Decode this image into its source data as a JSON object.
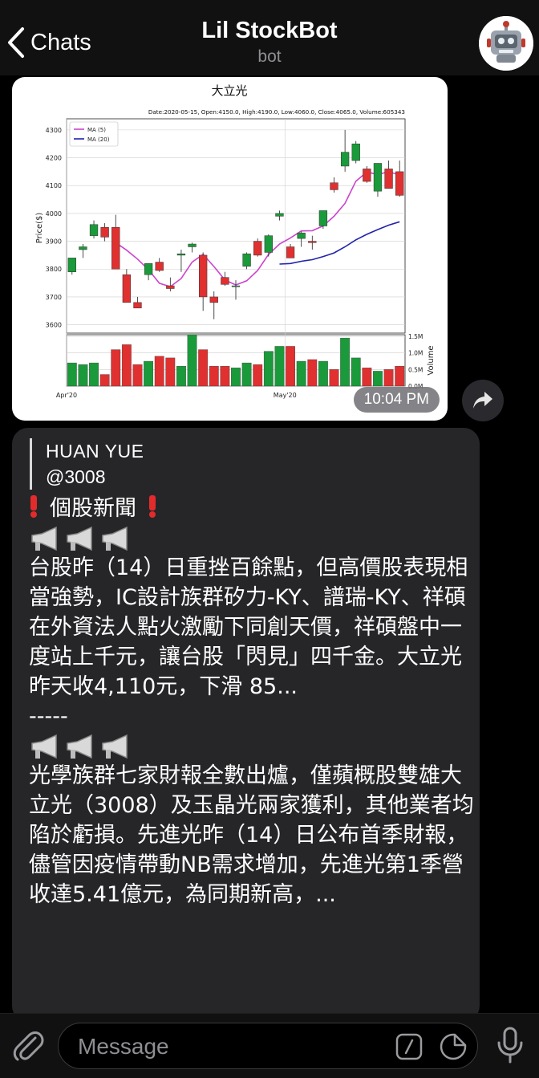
{
  "header": {
    "back_label": "Chats",
    "title": "Lil StockBot",
    "subtitle": "bot"
  },
  "image_message": {
    "time": "10:04 PM"
  },
  "chart_data": {
    "type": "candlestick",
    "title": "大立光",
    "subtitle": "Date:2020-05-15, Open:4150.0, High:4190.0, Low:4060.0, Close:4065.0, Volume:605343",
    "ylabel": "Price($)",
    "ylim": [
      3570,
      4340
    ],
    "yticks": [
      "3600",
      "3700",
      "3800",
      "3900",
      "4000",
      "4100",
      "4200",
      "4300"
    ],
    "x_ticks": [
      "Apr'20",
      "May'20"
    ],
    "volume_label": "Volume",
    "volume_ticks": [
      "0.0M",
      "0.5M",
      "1.0M",
      "1.5M"
    ],
    "volume_max": 1.55,
    "legend": [
      "MA (5)",
      "MA (20)"
    ],
    "colors": {
      "up": "#1a9a3a",
      "down": "#e03030",
      "ma5": "#cc44cc",
      "ma20": "#2222aa"
    },
    "candles": [
      {
        "o": 3790,
        "h": 3840,
        "l": 3780,
        "c": 3840,
        "v": 0.7
      },
      {
        "o": 3870,
        "h": 3890,
        "l": 3840,
        "c": 3880,
        "v": 0.65
      },
      {
        "o": 3920,
        "h": 3975,
        "l": 3910,
        "c": 3960,
        "v": 0.7
      },
      {
        "o": 3950,
        "h": 3965,
        "l": 3900,
        "c": 3915,
        "v": 0.35
      },
      {
        "o": 3950,
        "h": 3995,
        "l": 3800,
        "c": 3800,
        "v": 1.1
      },
      {
        "o": 3780,
        "h": 3800,
        "l": 3680,
        "c": 3680,
        "v": 1.25
      },
      {
        "o": 3680,
        "h": 3700,
        "l": 3660,
        "c": 3660,
        "v": 0.65
      },
      {
        "o": 3780,
        "h": 3820,
        "l": 3760,
        "c": 3820,
        "v": 0.75
      },
      {
        "o": 3825,
        "h": 3840,
        "l": 3790,
        "c": 3795,
        "v": 0.9
      },
      {
        "o": 3740,
        "h": 3770,
        "l": 3720,
        "c": 3730,
        "v": 0.85
      },
      {
        "o": 3850,
        "h": 3870,
        "l": 3790,
        "c": 3855,
        "v": 0.6
      },
      {
        "o": 3880,
        "h": 3895,
        "l": 3860,
        "c": 3890,
        "v": 1.7
      },
      {
        "o": 3850,
        "h": 3860,
        "l": 3650,
        "c": 3700,
        "v": 1.1
      },
      {
        "o": 3700,
        "h": 3720,
        "l": 3620,
        "c": 3680,
        "v": 0.6
      },
      {
        "o": 3770,
        "h": 3790,
        "l": 3740,
        "c": 3745,
        "v": 0.6
      },
      {
        "o": 3740,
        "h": 3760,
        "l": 3690,
        "c": 3740,
        "v": 0.55
      },
      {
        "o": 3810,
        "h": 3860,
        "l": 3800,
        "c": 3855,
        "v": 0.7
      },
      {
        "o": 3900,
        "h": 3910,
        "l": 3845,
        "c": 3850,
        "v": 0.65
      },
      {
        "o": 3860,
        "h": 3925,
        "l": 3845,
        "c": 3920,
        "v": 1.05
      },
      {
        "o": 3990,
        "h": 4010,
        "l": 3975,
        "c": 4000,
        "v": 1.2
      },
      {
        "o": 3880,
        "h": 3890,
        "l": 3840,
        "c": 3840,
        "v": 1.2
      },
      {
        "o": 3910,
        "h": 3935,
        "l": 3880,
        "c": 3930,
        "v": 0.75
      },
      {
        "o": 3900,
        "h": 3920,
        "l": 3870,
        "c": 3895,
        "v": 0.8
      },
      {
        "o": 3955,
        "h": 4010,
        "l": 3945,
        "c": 4010,
        "v": 0.75
      },
      {
        "o": 4110,
        "h": 4130,
        "l": 4075,
        "c": 4085,
        "v": 0.5
      },
      {
        "o": 4170,
        "h": 4300,
        "l": 4150,
        "c": 4220,
        "v": 1.45
      },
      {
        "o": 4190,
        "h": 4260,
        "l": 4180,
        "c": 4250,
        "v": 0.85
      },
      {
        "o": 4160,
        "h": 4170,
        "l": 4110,
        "c": 4115,
        "v": 0.55
      },
      {
        "o": 4080,
        "h": 4180,
        "l": 4060,
        "c": 4180,
        "v": 0.45
      },
      {
        "o": 4160,
        "h": 4190,
        "l": 4090,
        "c": 4090,
        "v": 0.5
      },
      {
        "o": 4150,
        "h": 4190,
        "l": 4060,
        "c": 4065,
        "v": 0.6
      }
    ],
    "ma5": [
      null,
      null,
      null,
      null,
      3895,
      3868,
      3836,
      3798,
      3749,
      3737,
      3766,
      3825,
      3853,
      3809,
      3761,
      3743,
      3758,
      3795,
      3853,
      3890,
      3912,
      3937,
      3938,
      3955,
      3990,
      4036,
      4116,
      4149,
      4140,
      4150,
      4138
    ],
    "ma20": [
      null,
      null,
      null,
      null,
      null,
      null,
      null,
      null,
      null,
      null,
      null,
      null,
      null,
      null,
      null,
      null,
      null,
      null,
      null,
      3818,
      3820,
      3828,
      3834,
      3845,
      3858,
      3880,
      3905,
      3925,
      3942,
      3958,
      3970
    ]
  },
  "forwarded_message": {
    "author": "HUAN YUE",
    "handle": "@3008",
    "header_line": "個股新聞",
    "paragraph1": "台股昨（14）日重挫百餘點，但高價股表現相當強勢，IC設計族群矽力-KY、譜瑞-KY、祥碩在外資法人點火激勵下同創天價，祥碩盤中一度站上千元，讓台股「閃見」四千金。大立光昨天收4,110元，下滑 85...",
    "divider": "-----",
    "paragraph2": "光學族群七家財報全數出爐，僅蘋概股雙雄大立光（3008）及玉晶光兩家獲利，其他業者均陷於虧損。先進光昨（14）日公布首季財報，儘管因疫情帶動NB需求增加，先進光第1季營收達5.41億元，為同期新高，..."
  },
  "input": {
    "placeholder": "Message"
  },
  "icons": [
    "chevron-left-icon",
    "robot-avatar-icon",
    "share-icon",
    "megaphone-icon",
    "chevron-down-icon",
    "paperclip-icon",
    "slash-command-icon",
    "sticker-icon",
    "microphone-icon"
  ]
}
